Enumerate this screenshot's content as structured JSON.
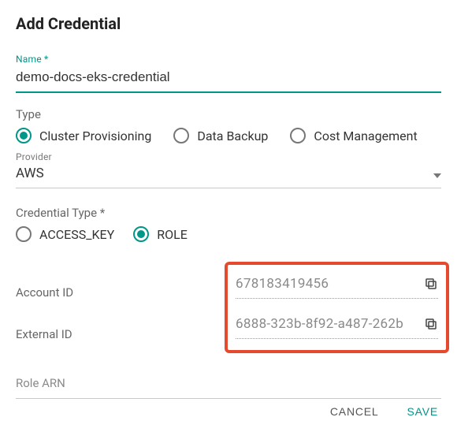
{
  "title": "Add Credential",
  "fields": {
    "name": {
      "label": "Name *",
      "value": "demo-docs-eks-credential"
    },
    "type": {
      "label": "Type",
      "options": [
        "Cluster Provisioning",
        "Data Backup",
        "Cost Management"
      ],
      "selected": "Cluster Provisioning"
    },
    "provider": {
      "label": "Provider",
      "value": "AWS"
    },
    "credential_type": {
      "label": "Credential Type *",
      "options": [
        "ACCESS_KEY",
        "ROLE"
      ],
      "selected": "ROLE"
    },
    "account_id": {
      "label": "Account ID",
      "value": "678183419456"
    },
    "external_id": {
      "label": "External ID",
      "value": "6888-323b-8f92-a487-262b"
    },
    "role_arn": {
      "label": "Role ARN",
      "value": ""
    }
  },
  "actions": {
    "cancel": "CANCEL",
    "save": "SAVE"
  },
  "colors": {
    "accent": "#009688",
    "callout": "#e64a2e"
  }
}
